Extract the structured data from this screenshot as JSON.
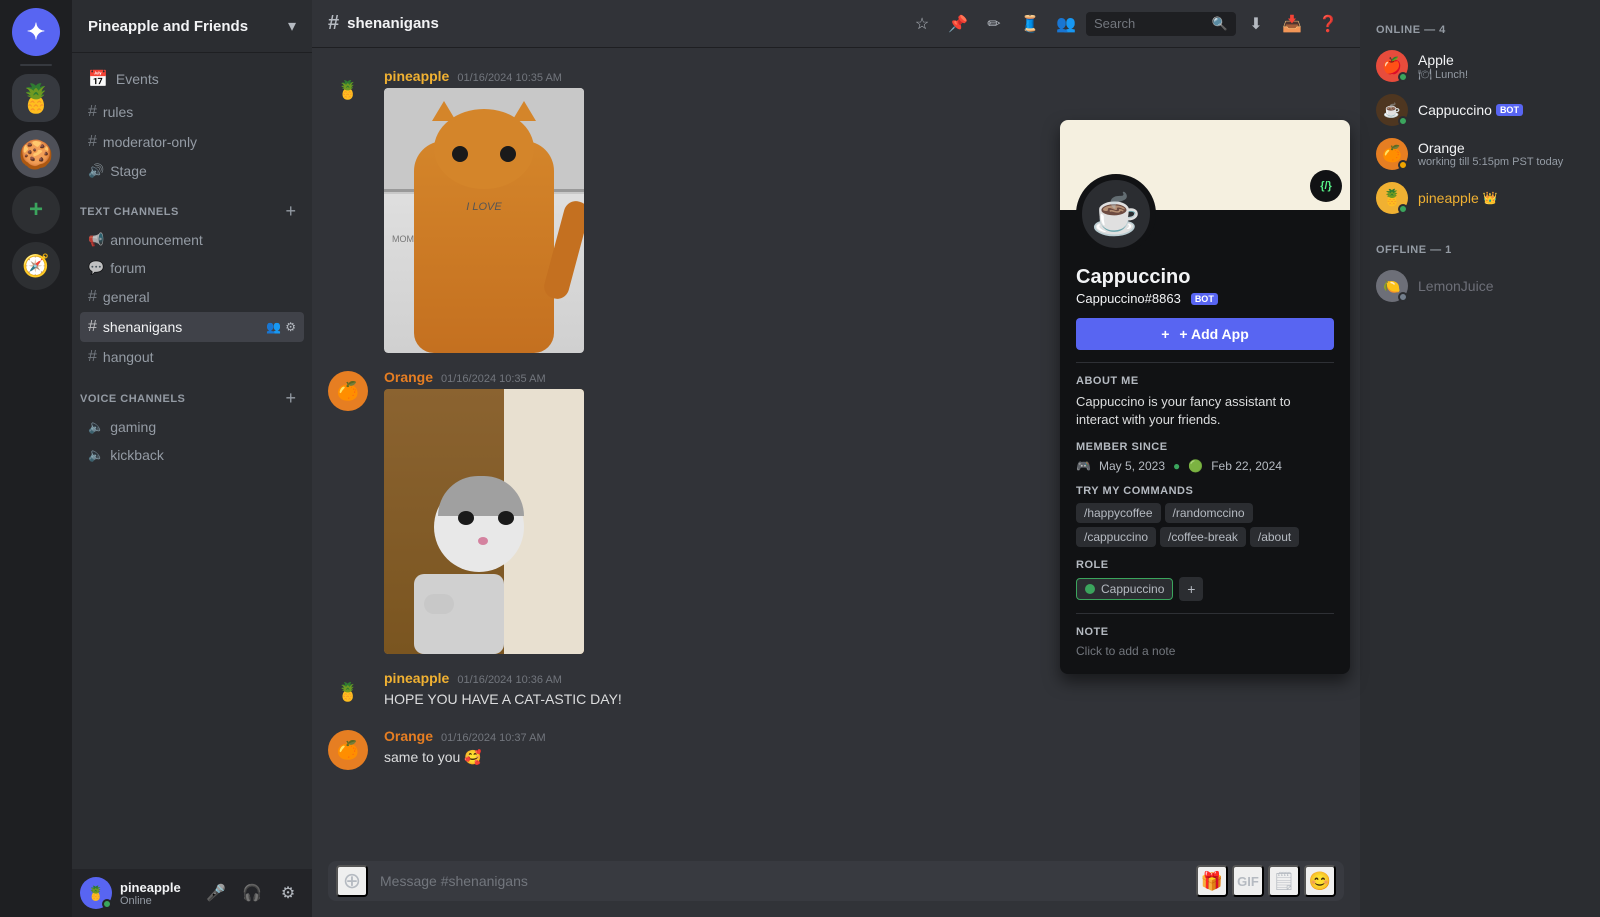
{
  "app": {
    "title": "Pineapple and Friends",
    "chevron": "▾"
  },
  "server_list": {
    "discord_icon": "✦",
    "pineapple_icon": "🍍",
    "cookie_icon": "🍪",
    "add_icon": "+"
  },
  "sidebar": {
    "events_label": "Events",
    "channels_label": "TEXT CHANNELS",
    "voice_label": "VOICE CHANNELS",
    "rules_channel": "rules",
    "moderator_channel": "moderator-only",
    "stage_channel": "Stage",
    "announcement_channel": "announcement",
    "forum_channel": "forum",
    "general_channel": "general",
    "shenanigans_channel": "shenanigans",
    "hangout_channel": "hangout",
    "gaming_voice": "gaming",
    "kickback_voice": "kickback",
    "add_channel_label": "+"
  },
  "user_panel": {
    "username": "pineapple",
    "status": "Online",
    "mic_icon": "🎤",
    "headphones_icon": "🎧",
    "settings_icon": "⚙"
  },
  "channel_header": {
    "channel_name": "shenanigans",
    "hash_icon": "#",
    "search_placeholder": "Search"
  },
  "messages": [
    {
      "author": "pineapple",
      "author_color": "pineapple",
      "timestamp": "01/16/2024 10:35 AM",
      "has_image": true,
      "image_type": "orange-cat"
    },
    {
      "author": "Orange",
      "author_color": "orange",
      "timestamp": "01/16/2024 10:35 AM",
      "has_image": true,
      "image_type": "gray-cat"
    },
    {
      "author": "pineapple",
      "author_color": "pineapple",
      "timestamp": "01/16/2024 10:36 AM",
      "text": "HOPE YOU HAVE A CAT-ASTIC DAY!"
    },
    {
      "author": "Orange",
      "author_color": "orange",
      "timestamp": "01/16/2024 10:37 AM",
      "text": "same to you 🥰"
    }
  ],
  "message_input": {
    "placeholder": "Message #shenanigans"
  },
  "members": {
    "online_header": "ONLINE — 4",
    "offline_header": "OFFLINE — 1",
    "online_members": [
      {
        "name": "Apple",
        "status": "online",
        "status_text": "🍽 Lunch!"
      },
      {
        "name": "Cappuccino",
        "status": "online",
        "is_bot": true
      },
      {
        "name": "Orange",
        "status": "working",
        "status_text": "working till 5:15pm PST today"
      },
      {
        "name": "pineapple",
        "status": "online",
        "has_crown": true
      }
    ],
    "offline_members": [
      {
        "name": "LemonJuice",
        "status": "offline"
      }
    ]
  },
  "profile_popup": {
    "name": "Cappuccino",
    "tag": "Cappuccino#8863",
    "is_bot": true,
    "add_app_label": "+ Add App",
    "about_me_title": "ABOUT ME",
    "about_me_text": "Cappuccino is your fancy assistant to interact with your friends.",
    "member_since_title": "MEMBER SINCE",
    "discord_date": "May 5, 2023",
    "server_date": "Feb 22, 2024",
    "commands_title": "TRY MY COMMANDS",
    "commands": [
      "/happycoffee",
      "/randomccino",
      "/cappuccino",
      "/coffee-break",
      "/about"
    ],
    "role_title": "ROLE",
    "role_name": "Cappuccino",
    "note_title": "NOTE",
    "note_placeholder": "Click to add a note",
    "code_icon": "{/}"
  }
}
